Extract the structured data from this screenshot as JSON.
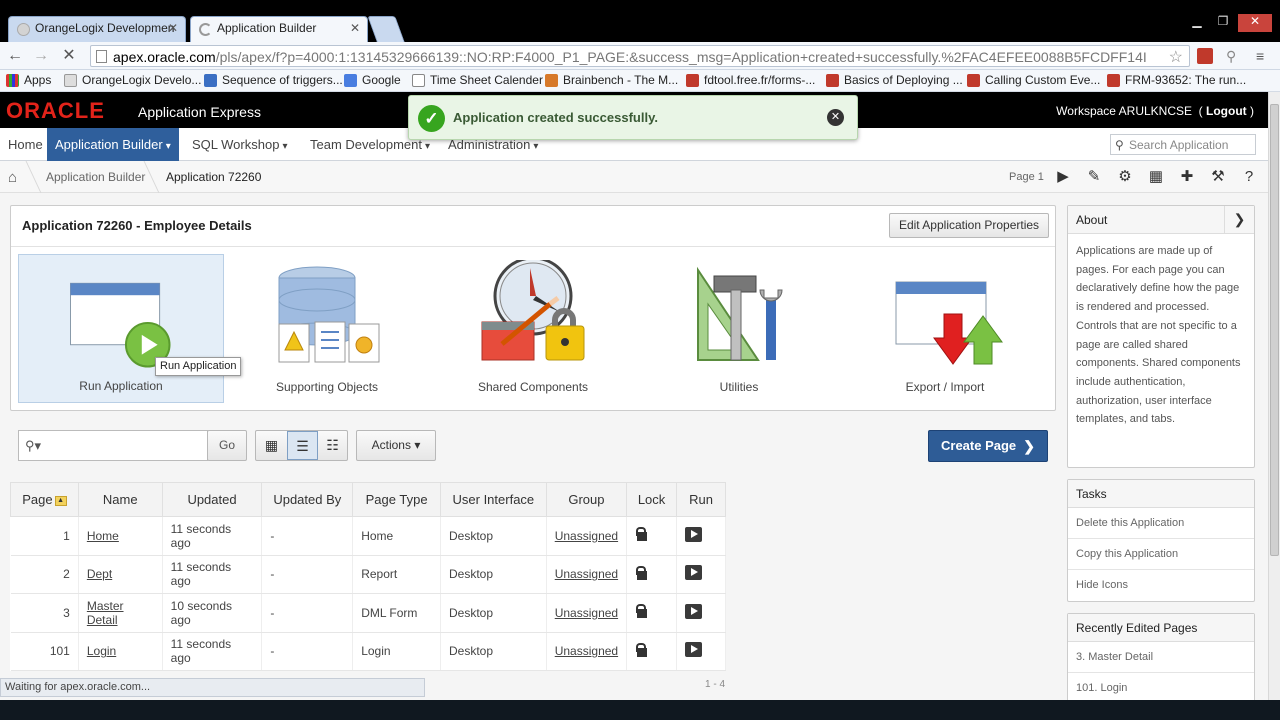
{
  "browser": {
    "tabs": [
      {
        "title": "OrangeLogix Developmen"
      },
      {
        "title": "Application Builder"
      }
    ],
    "url_host": "apex.oracle.com",
    "url_path": "/pls/apex/f?p=4000:1:13145329666139::NO:RP:F4000_P1_PAGE:&success_msg=Application+created+successfully.%2FAC4EFEE0088B5FCDFF14I",
    "bookmarks": [
      "Apps",
      "OrangeLogix Develo...",
      "Sequence of triggers...",
      "Google",
      "Time Sheet Calender",
      "Brainbench - The M...",
      "fdtool.free.fr/forms-...",
      "Basics of Deploying ...",
      "Calling Custom Eve...",
      "FRM-93652: The run..."
    ],
    "status": "Waiting for apex.oracle.com..."
  },
  "header": {
    "brand": "ORACLE",
    "product": "Application Express",
    "workspace_label": "Workspace ARULKNCSE",
    "logout_label": "Logout"
  },
  "nav": {
    "items": [
      "Home",
      "Application Builder",
      "SQL Workshop",
      "Team Development",
      "Administration"
    ],
    "search_placeholder": "Search Application"
  },
  "breadcrumb": {
    "items": [
      "Application Builder",
      "Application 72260"
    ],
    "page_label": "Page 1"
  },
  "notification": {
    "message": "Application created successfully."
  },
  "app_region": {
    "title": "Application 72260 - Employee Details",
    "edit_button": "Edit Application Properties",
    "tiles": [
      "Run Application",
      "Supporting Objects",
      "Shared Components",
      "Utilities",
      "Export / Import"
    ],
    "tooltip": "Run Application"
  },
  "grid_toolbar": {
    "go_label": "Go",
    "actions_label": "Actions",
    "create_page_label": "Create Page"
  },
  "table": {
    "headers": [
      "Page",
      "Name",
      "Updated",
      "Updated By",
      "Page Type",
      "User Interface",
      "Group",
      "Lock",
      "Run"
    ],
    "rows": [
      {
        "page": "1",
        "name": "Home",
        "updated": "11 seconds ago",
        "updated_by": "-",
        "page_type": "Home",
        "ui": "Desktop",
        "group": "Unassigned"
      },
      {
        "page": "2",
        "name": "Dept",
        "updated": "11 seconds ago",
        "updated_by": "-",
        "page_type": "Report",
        "ui": "Desktop",
        "group": "Unassigned"
      },
      {
        "page": "3",
        "name": "Master Detail",
        "updated": "10 seconds ago",
        "updated_by": "-",
        "page_type": "DML Form",
        "ui": "Desktop",
        "group": "Unassigned"
      },
      {
        "page": "101",
        "name": "Login",
        "updated": "11 seconds ago",
        "updated_by": "-",
        "page_type": "Login",
        "ui": "Desktop",
        "group": "Unassigned"
      }
    ],
    "pagination": "1 - 4"
  },
  "sidebar": {
    "about_title": "About",
    "about_text": "Applications are made up of pages. For each page you can declaratively define how the page is rendered and processed. Controls that are not specific to a page are called shared components. Shared components include authentication, authorization, user interface templates, and tabs.",
    "tasks_title": "Tasks",
    "tasks": [
      "Delete this Application",
      "Copy this Application",
      "Hide Icons"
    ],
    "recent_title": "Recently Edited Pages",
    "recent": [
      "3. Master Detail",
      "101. Login"
    ]
  },
  "colors": {
    "oracle_red": "#e2231a",
    "nav_active": "#2f5f9c",
    "create_page": "#2e5c96",
    "success_green": "#37a51f"
  }
}
